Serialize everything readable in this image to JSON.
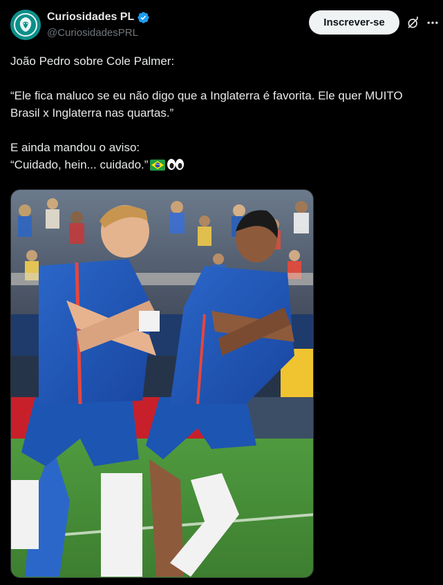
{
  "author": {
    "display_name": "Curiosidades PL",
    "handle": "@CuriosidadesPRL",
    "verified": true,
    "avatar_icon": "lion-crest-icon"
  },
  "actions": {
    "follow_label": "Inscrever-se",
    "grok_icon": "grok-icon",
    "more_icon": "more-icon"
  },
  "tweet": {
    "line1": "João Pedro sobre Cole Palmer:",
    "line2": "“Ele fica maluco se eu não digo que a Inglaterra é favorita. Ele quer MUITO Brasil x Inglaterra nas quartas.”",
    "line3": "E ainda mandou o aviso:",
    "line4": "“Cuidado, hein... cuidado.”",
    "emojis": [
      "brazil-flag",
      "eyes"
    ]
  },
  "media": {
    "type": "photo"
  },
  "colors": {
    "background": "#000000",
    "text": "#e7e9ea",
    "muted": "#71767b",
    "verified": "#1d9bf0",
    "follow_bg": "#eff3f4",
    "avatar": "#0b8a86"
  }
}
